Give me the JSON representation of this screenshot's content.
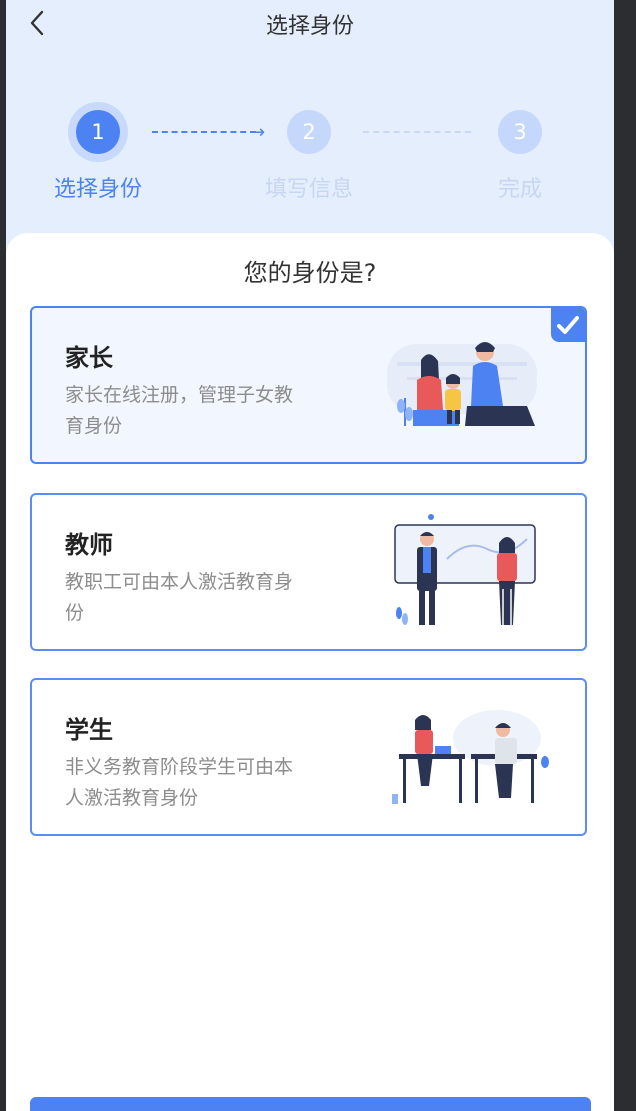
{
  "header": {
    "title": "选择身份",
    "back_icon": "chevron-left-icon"
  },
  "steps": [
    {
      "number": "1",
      "label": "选择身份",
      "state": "active"
    },
    {
      "number": "2",
      "label": "填写信息",
      "state": "pending"
    },
    {
      "number": "3",
      "label": "完成",
      "state": "pending"
    }
  ],
  "question": "您的身份是?",
  "cards": [
    {
      "title": "家长",
      "desc": "家长在线注册，管理子女教育身份",
      "selected": true,
      "illustration": "family-illustration"
    },
    {
      "title": "教师",
      "desc": "教职工可由本人激活教育身份",
      "selected": false,
      "illustration": "teacher-illustration"
    },
    {
      "title": "学生",
      "desc": "非义务教育阶段学生可由本人激活教育身份",
      "selected": false,
      "illustration": "student-illustration"
    }
  ],
  "colors": {
    "primary": "#4d82f3",
    "header_bg": "#e4eefc",
    "muted_text": "#8d8d8d"
  }
}
